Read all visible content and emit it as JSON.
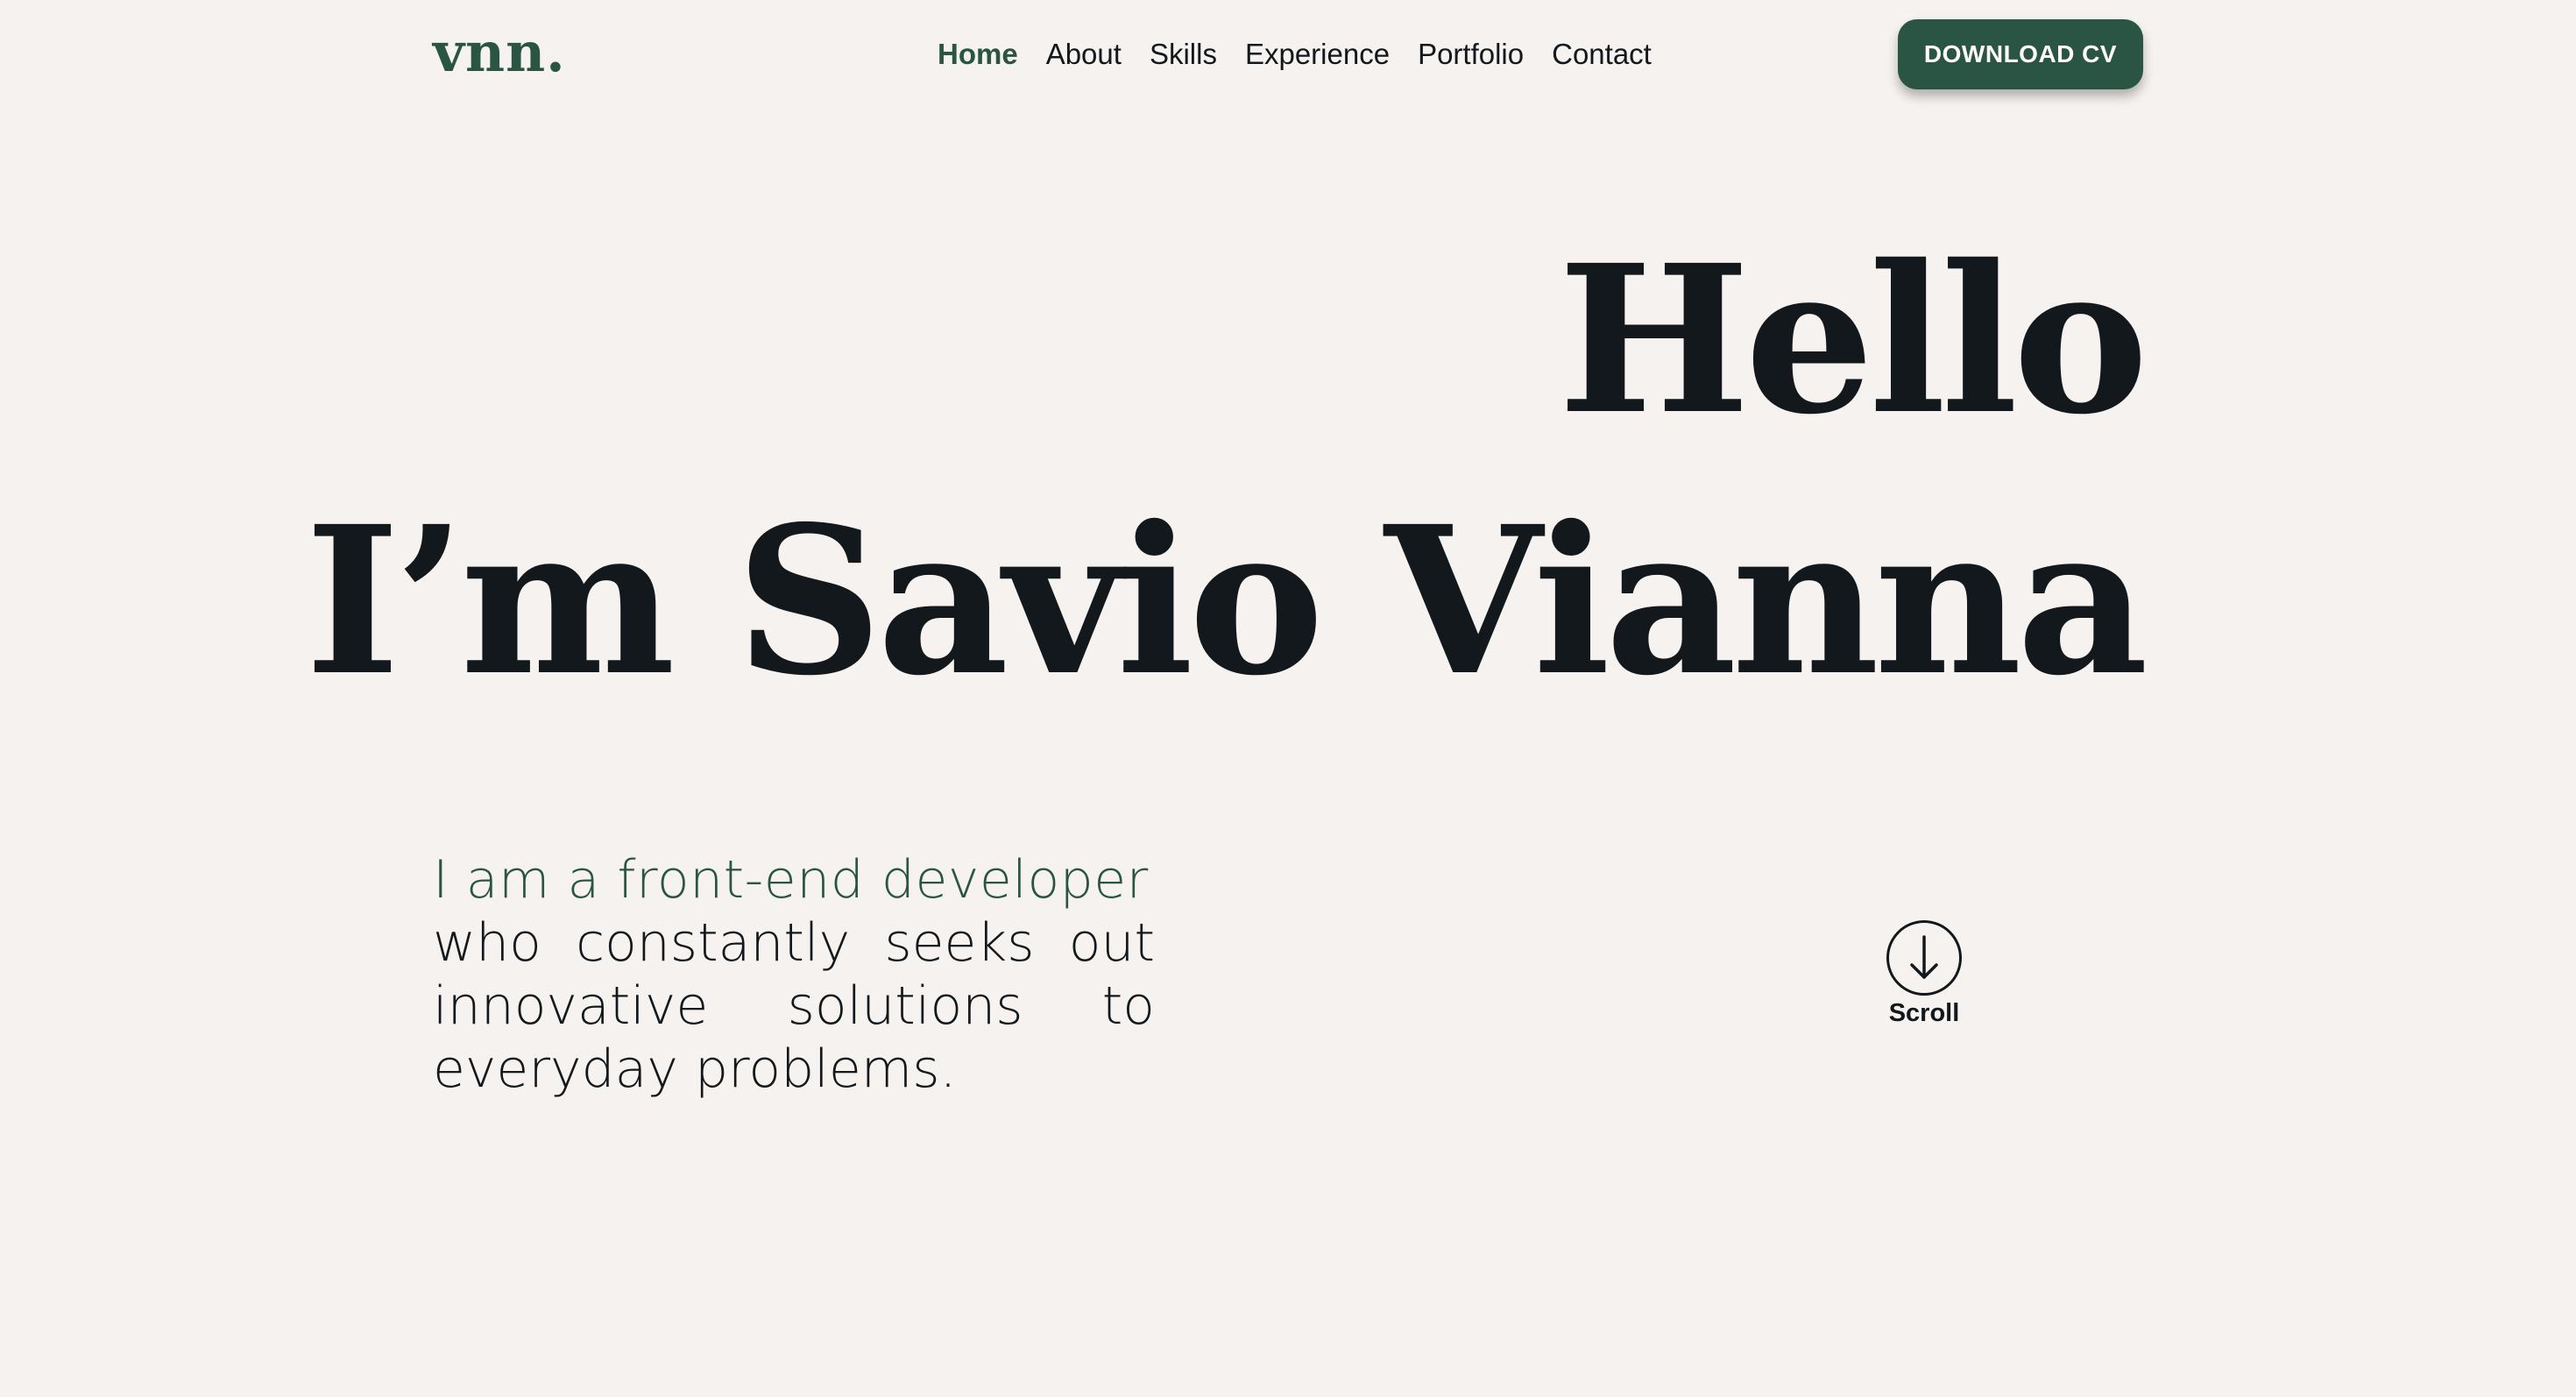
{
  "header": {
    "logo": "vnn.",
    "nav": [
      {
        "label": "Home",
        "active": true
      },
      {
        "label": "About",
        "active": false
      },
      {
        "label": "Skills",
        "active": false
      },
      {
        "label": "Experience",
        "active": false
      },
      {
        "label": "Portfolio",
        "active": false
      },
      {
        "label": "Contact",
        "active": false
      }
    ],
    "cta_label": "DOWNLOAD CV"
  },
  "hero": {
    "greeting": "Hello",
    "name_line": "I’m Savio Vianna"
  },
  "intro": {
    "accent": "I am a front-end developer",
    "text": "who constantly seeks out innovative solutions to everyday problems."
  },
  "scroll": {
    "label": "Scroll",
    "icon": "arrow-down-circle-icon"
  },
  "colors": {
    "background": "#f5f2ef",
    "accent": "#2a5444",
    "text": "#12181b",
    "button_text": "#ffffff"
  }
}
